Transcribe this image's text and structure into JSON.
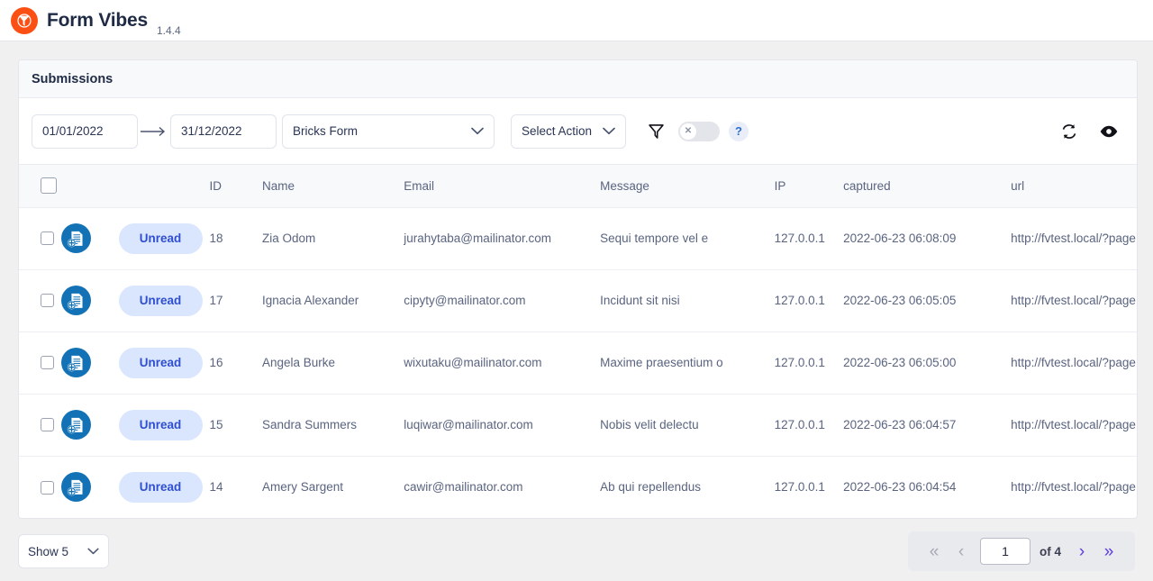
{
  "app": {
    "title": "Form Vibes",
    "version": "1.4.4",
    "logo_icon": "form-vibes-logo",
    "brand_color": "#fb4f14"
  },
  "card": {
    "heading": "Submissions"
  },
  "toolbar": {
    "date_from": "01/01/2022",
    "date_to": "31/12/2022",
    "date_arrow_icon": "arrow-right-icon",
    "form_select": "Bricks Form",
    "action_select": "Select Action",
    "filter_icon": "funnel-icon",
    "toggle_state_icon": "close-x-icon",
    "toggle_on": false,
    "help_label": "?",
    "refresh_icon": "refresh-icon",
    "view_icon": "eye-icon"
  },
  "table": {
    "columns": [
      "",
      "",
      "",
      "ID",
      "Name",
      "Email",
      "Message",
      "IP",
      "captured",
      "url"
    ],
    "rows": [
      {
        "status": "Unread",
        "id": "18",
        "name": "Zia Odom",
        "email": "jurahytaba@mailinator.com",
        "message": "Sequi tempore vel e",
        "ip": "127.0.0.1",
        "captured": "2022-06-23 06:08:09",
        "url": "http://fvtest.local/?page"
      },
      {
        "status": "Unread",
        "id": "17",
        "name": "Ignacia Alexander",
        "email": "cipyty@mailinator.com",
        "message": "Incidunt sit nisi",
        "ip": "127.0.0.1",
        "captured": "2022-06-23 06:05:05",
        "url": "http://fvtest.local/?page"
      },
      {
        "status": "Unread",
        "id": "16",
        "name": "Angela Burke",
        "email": "wixutaku@mailinator.com",
        "message": "Maxime praesentium o",
        "ip": "127.0.0.1",
        "captured": "2022-06-23 06:05:00",
        "url": "http://fvtest.local/?page"
      },
      {
        "status": "Unread",
        "id": "15",
        "name": "Sandra Summers",
        "email": "luqiwar@mailinator.com",
        "message": "Nobis velit delectu",
        "ip": "127.0.0.1",
        "captured": "2022-06-23 06:04:57",
        "url": "http://fvtest.local/?page"
      },
      {
        "status": "Unread",
        "id": "14",
        "name": "Amery Sargent",
        "email": "cawir@mailinator.com",
        "message": "Ab qui repellendus",
        "ip": "127.0.0.1",
        "captured": "2022-06-23 06:04:54",
        "url": "http://fvtest.local/?page"
      }
    ],
    "row_icon": "add-entry-document-icon",
    "status_color_bg": "#d9e6fd",
    "status_color_text": "#2f4fd0"
  },
  "footer": {
    "per_page": "Show 5",
    "first_icon": "double-chevron-left-icon",
    "prev_icon": "chevron-left-icon",
    "page_value": "1",
    "total_label": "of 4",
    "next_icon": "chevron-right-icon",
    "last_icon": "double-chevron-right-icon"
  }
}
